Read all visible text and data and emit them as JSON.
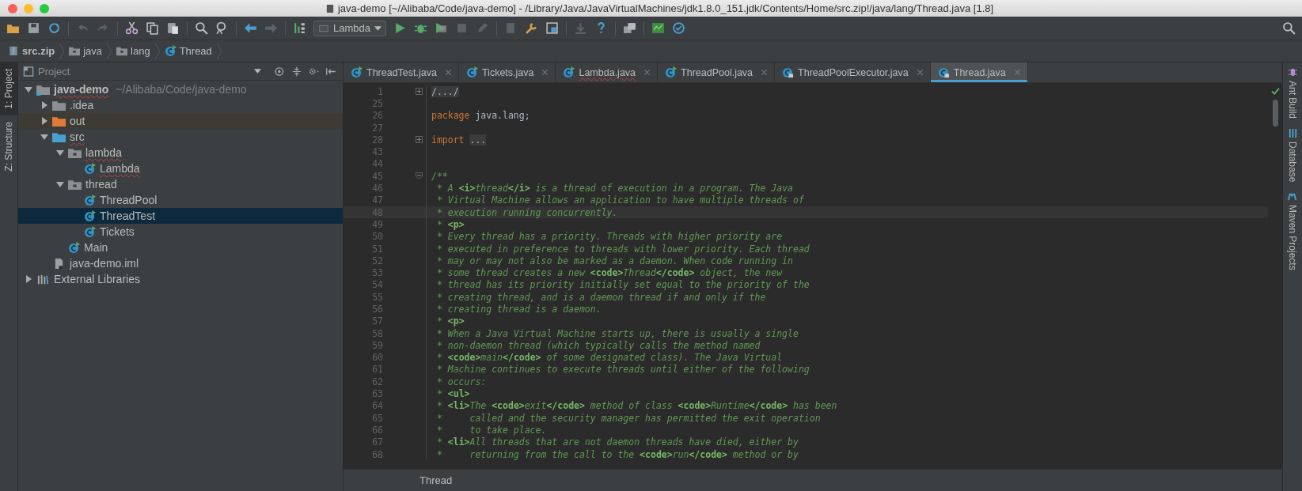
{
  "window": {
    "title": "java-demo [~/Alibaba/Code/java-demo] - /Library/Java/JavaVirtualMachines/jdk1.8.0_151.jdk/Contents/Home/src.zip!/java/lang/Thread.java [1.8]"
  },
  "toolbar": {
    "run_configuration": "Lambda"
  },
  "breadcrumbs": [
    {
      "label": "src.zip",
      "kind": "archive"
    },
    {
      "label": "java",
      "kind": "package"
    },
    {
      "label": "lang",
      "kind": "package"
    },
    {
      "label": "Thread",
      "kind": "class"
    }
  ],
  "left_tool_windows": [
    {
      "label": "1: Project",
      "selected": true
    },
    {
      "label": "Z: Structure",
      "selected": false
    }
  ],
  "project_panel": {
    "title": "Project",
    "tree": [
      {
        "label": "java-demo",
        "path": "~/Alibaba/Code/java-demo",
        "kind": "module",
        "expanded": true,
        "selected": false,
        "error": true,
        "children": [
          {
            "label": ".idea",
            "kind": "folder",
            "expanded": false,
            "selected": false,
            "error": false
          },
          {
            "label": "out",
            "kind": "excluded-folder",
            "expanded": false,
            "selected": false,
            "error": false
          },
          {
            "label": "src",
            "kind": "source-folder",
            "expanded": true,
            "selected": false,
            "error": true,
            "children": [
              {
                "label": "lambda",
                "kind": "package",
                "expanded": true,
                "selected": false,
                "error": true,
                "children": [
                  {
                    "label": "Lambda",
                    "kind": "class",
                    "selected": false,
                    "error": true
                  }
                ]
              },
              {
                "label": "thread",
                "kind": "package",
                "expanded": true,
                "selected": false,
                "error": false,
                "children": [
                  {
                    "label": "ThreadPool",
                    "kind": "class",
                    "selected": false,
                    "error": false
                  },
                  {
                    "label": "ThreadTest",
                    "kind": "class",
                    "selected": true,
                    "error": false
                  },
                  {
                    "label": "Tickets",
                    "kind": "class",
                    "selected": false,
                    "error": false
                  }
                ]
              },
              {
                "label": "Main",
                "kind": "class",
                "selected": false,
                "error": false
              }
            ]
          },
          {
            "label": "java-demo.iml",
            "kind": "file",
            "selected": false,
            "error": false
          }
        ]
      },
      {
        "label": "External Libraries",
        "kind": "libraries",
        "expanded": false,
        "selected": false,
        "error": false
      }
    ]
  },
  "editor_tabs": [
    {
      "label": "ThreadTest.java",
      "selected": false,
      "locked": false,
      "error": false
    },
    {
      "label": "Tickets.java",
      "selected": false,
      "locked": false,
      "error": false
    },
    {
      "label": "Lambda.java",
      "selected": false,
      "locked": false,
      "error": true
    },
    {
      "label": "ThreadPool.java",
      "selected": false,
      "locked": false,
      "error": false
    },
    {
      "label": "ThreadPoolExecutor.java",
      "selected": false,
      "locked": true,
      "error": false
    },
    {
      "label": "Thread.java",
      "selected": true,
      "locked": true,
      "error": false
    }
  ],
  "code_lines": [
    {
      "number": "1",
      "current": false,
      "kind": "folded",
      "segments": [
        {
          "kind": "folded",
          "text": "/.../"
        }
      ]
    },
    {
      "number": "25",
      "kind": "plain"
    },
    {
      "number": "26",
      "current": false,
      "kind": "plain",
      "segments": [
        {
          "kind": "keyword",
          "text": "package"
        },
        {
          "kind": "plain",
          "text": " java.lang;"
        }
      ]
    },
    {
      "number": "27",
      "kind": "plain"
    },
    {
      "number": "28",
      "current": false,
      "kind": "folded",
      "segments": [
        {
          "kind": "keyword",
          "text": "import "
        },
        {
          "kind": "folded",
          "text": "..."
        }
      ]
    },
    {
      "number": "43",
      "kind": "plain"
    },
    {
      "number": "44",
      "kind": "plain"
    },
    {
      "number": "45",
      "current": false,
      "kind": "foldable",
      "segments": [
        {
          "kind": "comment",
          "text": "/**"
        }
      ]
    },
    {
      "number": "46",
      "current": false,
      "kind": "plain",
      "segments": [
        {
          "kind": "comment",
          "text": " * A "
        },
        {
          "kind": "tag",
          "text": "<i>"
        },
        {
          "kind": "comment",
          "text": "thread"
        },
        {
          "kind": "tag",
          "text": "</i>"
        },
        {
          "kind": "comment",
          "text": " is a thread of execution in a program. The Java"
        }
      ]
    },
    {
      "number": "47",
      "current": false,
      "kind": "plain",
      "segments": [
        {
          "kind": "comment",
          "text": " * Virtual Machine allows an application to have multiple threads of"
        }
      ]
    },
    {
      "number": "48",
      "current": true,
      "kind": "plain",
      "segments": [
        {
          "kind": "comment",
          "text": " * execution running concurrently."
        }
      ]
    },
    {
      "number": "49",
      "current": false,
      "kind": "plain",
      "segments": [
        {
          "kind": "comment",
          "text": " * "
        },
        {
          "kind": "tag",
          "text": "<p>"
        }
      ]
    },
    {
      "number": "50",
      "current": false,
      "kind": "plain",
      "segments": [
        {
          "kind": "comment",
          "text": " * Every thread has a priority. Threads with higher priority are"
        }
      ]
    },
    {
      "number": "51",
      "current": false,
      "kind": "plain",
      "segments": [
        {
          "kind": "comment",
          "text": " * executed in preference to threads with lower priority. Each thread"
        }
      ]
    },
    {
      "number": "52",
      "current": false,
      "kind": "plain",
      "segments": [
        {
          "kind": "comment",
          "text": " * may or may not also be marked as a daemon. When code running in"
        }
      ]
    },
    {
      "number": "53",
      "current": false,
      "kind": "plain",
      "segments": [
        {
          "kind": "comment",
          "text": " * some thread creates a new "
        },
        {
          "kind": "tag",
          "text": "<code>"
        },
        {
          "kind": "comment",
          "text": "Thread"
        },
        {
          "kind": "tag",
          "text": "</code>"
        },
        {
          "kind": "comment",
          "text": " object, the new"
        }
      ]
    },
    {
      "number": "54",
      "current": false,
      "kind": "plain",
      "segments": [
        {
          "kind": "comment",
          "text": " * thread has its priority initially set equal to the priority of the"
        }
      ]
    },
    {
      "number": "55",
      "current": false,
      "kind": "plain",
      "segments": [
        {
          "kind": "comment",
          "text": " * creating thread, and is a daemon thread if and only if the"
        }
      ]
    },
    {
      "number": "56",
      "current": false,
      "kind": "plain",
      "segments": [
        {
          "kind": "comment",
          "text": " * creating thread is a daemon."
        }
      ]
    },
    {
      "number": "57",
      "current": false,
      "kind": "plain",
      "segments": [
        {
          "kind": "comment",
          "text": " * "
        },
        {
          "kind": "tag",
          "text": "<p>"
        }
      ]
    },
    {
      "number": "58",
      "current": false,
      "kind": "plain",
      "segments": [
        {
          "kind": "comment",
          "text": " * When a Java Virtual Machine starts up, there is usually a single"
        }
      ]
    },
    {
      "number": "59",
      "current": false,
      "kind": "plain",
      "segments": [
        {
          "kind": "comment",
          "text": " * non-daemon thread (which typically calls the method named"
        }
      ]
    },
    {
      "number": "60",
      "current": false,
      "kind": "plain",
      "segments": [
        {
          "kind": "comment",
          "text": " * "
        },
        {
          "kind": "tag",
          "text": "<code>"
        },
        {
          "kind": "comment",
          "text": "main"
        },
        {
          "kind": "tag",
          "text": "</code>"
        },
        {
          "kind": "comment",
          "text": " of some designated class). The Java Virtual"
        }
      ]
    },
    {
      "number": "61",
      "current": false,
      "kind": "plain",
      "segments": [
        {
          "kind": "comment",
          "text": " * Machine continues to execute threads until either of the following"
        }
      ]
    },
    {
      "number": "62",
      "current": false,
      "kind": "plain",
      "segments": [
        {
          "kind": "comment",
          "text": " * occurs:"
        }
      ]
    },
    {
      "number": "63",
      "current": false,
      "kind": "plain",
      "segments": [
        {
          "kind": "comment",
          "text": " * "
        },
        {
          "kind": "tag",
          "text": "<ul>"
        }
      ]
    },
    {
      "number": "64",
      "current": false,
      "kind": "plain",
      "segments": [
        {
          "kind": "comment",
          "text": " * "
        },
        {
          "kind": "tag",
          "text": "<li>"
        },
        {
          "kind": "comment",
          "text": "The "
        },
        {
          "kind": "tag",
          "text": "<code>"
        },
        {
          "kind": "comment",
          "text": "exit"
        },
        {
          "kind": "tag",
          "text": "</code>"
        },
        {
          "kind": "comment",
          "text": " method of class "
        },
        {
          "kind": "tag",
          "text": "<code>"
        },
        {
          "kind": "comment",
          "text": "Runtime"
        },
        {
          "kind": "tag",
          "text": "</code>"
        },
        {
          "kind": "comment",
          "text": " has been"
        }
      ]
    },
    {
      "number": "65",
      "current": false,
      "kind": "plain",
      "segments": [
        {
          "kind": "comment",
          "text": " *     called and the security manager has permitted the exit operation"
        }
      ]
    },
    {
      "number": "66",
      "current": false,
      "kind": "plain",
      "segments": [
        {
          "kind": "comment",
          "text": " *     to take place."
        }
      ]
    },
    {
      "number": "67",
      "current": false,
      "kind": "plain",
      "segments": [
        {
          "kind": "comment",
          "text": " * "
        },
        {
          "kind": "tag",
          "text": "<li>"
        },
        {
          "kind": "comment",
          "text": "All threads that are not daemon threads have died, either by"
        }
      ]
    },
    {
      "number": "68",
      "current": false,
      "kind": "plain",
      "segments": [
        {
          "kind": "comment",
          "text": " *     returning from the call to the "
        },
        {
          "kind": "tag",
          "text": "<code>"
        },
        {
          "kind": "comment",
          "text": "run"
        },
        {
          "kind": "tag",
          "text": "</code>"
        },
        {
          "kind": "comment",
          "text": " method or by"
        }
      ]
    }
  ],
  "editor_breadcrumb": "Thread",
  "right_tool_windows": [
    {
      "label": "Ant Build",
      "kind": "ant"
    },
    {
      "label": "Database",
      "kind": "database"
    },
    {
      "label": "Maven Projects",
      "kind": "maven"
    }
  ]
}
